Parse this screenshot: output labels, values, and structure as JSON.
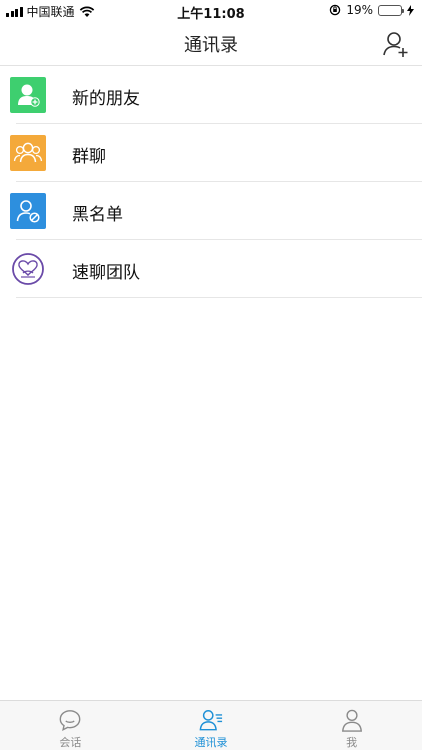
{
  "status_bar": {
    "carrier": "中国联通",
    "time": "上午11:08",
    "battery_percent": "19%",
    "battery_level": 0.19
  },
  "nav": {
    "title": "通讯录",
    "add_icon": "add-contact-icon"
  },
  "list": [
    {
      "label": "新的朋友",
      "icon": "new-friend-icon",
      "color": "#3ecf6f"
    },
    {
      "label": "群聊",
      "icon": "group-chat-icon",
      "color": "#f4a93a"
    },
    {
      "label": "黑名单",
      "icon": "blacklist-icon",
      "color": "#2d8fde"
    },
    {
      "label": "速聊团队",
      "icon": "team-logo-icon",
      "color": "#6a4aa8"
    }
  ],
  "tabs": [
    {
      "label": "会话",
      "icon": "chat-bubble-icon",
      "active": false
    },
    {
      "label": "通讯录",
      "icon": "contacts-icon",
      "active": true
    },
    {
      "label": "我",
      "icon": "profile-icon",
      "active": false
    }
  ],
  "colors": {
    "accent": "#1e90d6",
    "inactive": "#8a8a8a"
  }
}
